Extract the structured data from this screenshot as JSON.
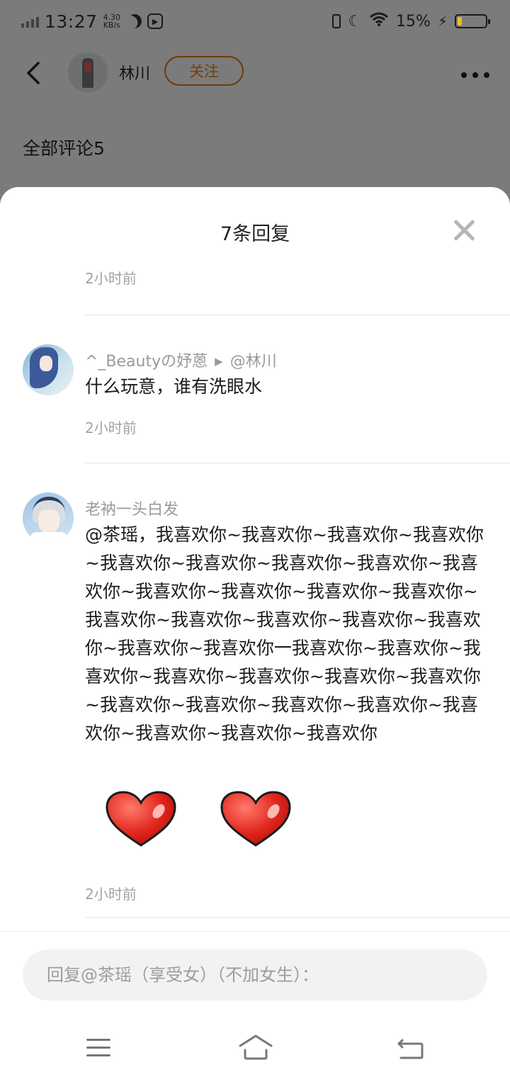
{
  "status_bar": {
    "time": "13:27",
    "net_speed_value": "4.30",
    "net_speed_unit": "KB/s",
    "battery_percent": "15%",
    "battery_level": 0.15
  },
  "header": {
    "username": "林川",
    "follow_label": "关注",
    "more_icon": "more-dots-icon",
    "back_icon": "chevron-left-icon"
  },
  "comments_section": {
    "title": "全部评论5"
  },
  "sheet": {
    "title": "7条回复",
    "top_cutoff_time": "2小时前",
    "replies": [
      {
        "author": "^_Beautyの妤蒽",
        "reply_to": "@林川",
        "text": "什么玩意，谁有洗眼水",
        "time": "2小时前"
      },
      {
        "author": "老衲一头白发",
        "text": "@茶瑶，我喜欢你~我喜欢你~我喜欢你~我喜欢你~我喜欢你~我喜欢你~我喜欢你~我喜欢你~我喜欢你~我喜欢你~我喜欢你~我喜欢你~我喜欢你~我喜欢你~我喜欢你~我喜欢你~我喜欢你~我喜欢你~我喜欢你~我喜欢你一我喜欢你~我喜欢你~我喜欢你~我喜欢你~我喜欢你~我喜欢你~我喜欢你~我喜欢你~我喜欢你~我喜欢你~我喜欢你~我喜欢你~我喜欢你~我喜欢你~我喜欢你",
        "emojis": [
          "heart-emoji",
          "heart-emoji"
        ],
        "time": "2小时前"
      }
    ]
  },
  "reply_input": {
    "placeholder": "回复@茶瑶（享受女）（不加女生）："
  },
  "colors": {
    "follow_border": "#6d3a08",
    "overlay_bg": "#7b7b7b",
    "meta_text": "#a2a2a2",
    "heart_red": "#e0241c"
  }
}
